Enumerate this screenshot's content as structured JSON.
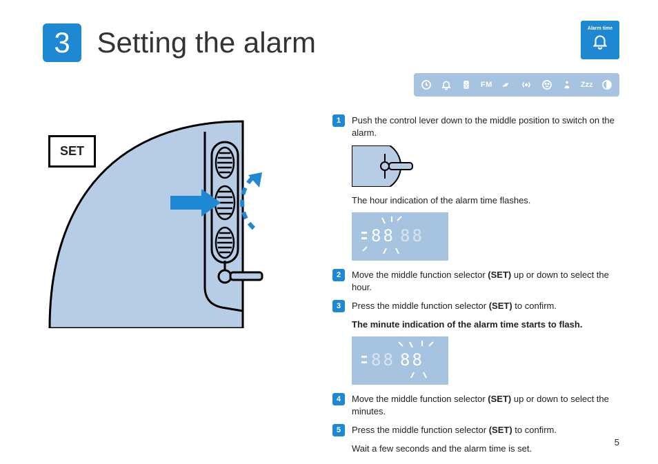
{
  "chapter": {
    "number": "3",
    "title": "Setting the alarm"
  },
  "mode_badge": {
    "label": "Alarm time",
    "icon": "bell-icon"
  },
  "icon_row": [
    {
      "name": "clock-icon"
    },
    {
      "name": "bell-icon"
    },
    {
      "name": "mp3-player-icon"
    },
    {
      "name": "fm-label",
      "text": "FM"
    },
    {
      "name": "bird-icon"
    },
    {
      "name": "radio-signal-icon"
    },
    {
      "name": "face-icon"
    },
    {
      "name": "person-icon"
    },
    {
      "name": "snooze-zzz-icon",
      "text": "Zzz"
    },
    {
      "name": "contrast-icon"
    }
  ],
  "left_figure": {
    "set_label": "SET"
  },
  "steps": [
    {
      "n": "1",
      "text": "Push the control lever down to the middle position to switch on the alarm."
    },
    {
      "n": "2",
      "text_parts": [
        "Move the middle function selector ",
        "(SET)",
        " up or down to select the hour."
      ]
    },
    {
      "n": "3",
      "text_parts": [
        "Press the middle function selector ",
        "(SET)",
        " to confirm."
      ]
    },
    {
      "n": "4",
      "text_parts": [
        "Move the middle function selector ",
        "(SET)",
        " up or down to select the minutes."
      ]
    },
    {
      "n": "5",
      "text_parts": [
        "Press the middle function selector ",
        "(SET)",
        " to confirm."
      ]
    }
  ],
  "notes": {
    "after_step1": "The hour indication of the alarm time flashes.",
    "after_step3": "The minute indication of the alarm time starts to flash.",
    "after_step5": "Wait a few seconds and the alarm time is set."
  },
  "mini_display": {
    "hour_digits": "88",
    "minute_digits": "88",
    "full_after3": "8888"
  },
  "page_number": "5"
}
